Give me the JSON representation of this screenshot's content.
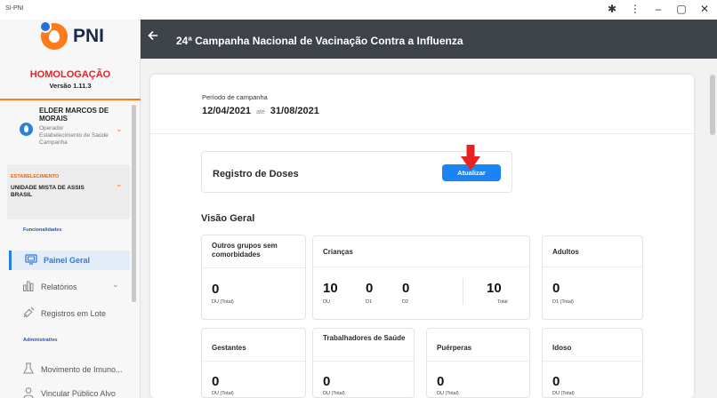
{
  "window": {
    "app_name": "SI-PNI",
    "controls": {
      "extensions": "✱",
      "menu": "⋮",
      "minimize": "–",
      "maximize": "▢",
      "close": "✕"
    }
  },
  "sidebar": {
    "logo_text": "PNI",
    "environment": "HOMOLOGAÇÃO",
    "version": "Versão 1.11.3",
    "user": {
      "name": "ELDER MARCOS DE MORAIS",
      "role": "Operador",
      "unit": "Estabelecimento de Saúde Campanha"
    },
    "establishment": {
      "title": "ESTABELECIMENTO",
      "name": "UNIDADE MISTA DE ASSIS BRASIL"
    },
    "sections": [
      {
        "label": "Funcionalidades"
      },
      {
        "label": "Administrativo"
      }
    ],
    "nav": [
      {
        "label": "Painel Geral",
        "icon": "monitor-icon",
        "active": true
      },
      {
        "label": "Relatórios",
        "icon": "chart-icon",
        "active": false
      },
      {
        "label": "Registros em Lote",
        "icon": "syringe-icon",
        "active": false
      },
      {
        "label": "Movimento de Imuno...",
        "icon": "flask-icon",
        "active": false
      },
      {
        "label": "Vincular Público Alvo",
        "icon": "user-link-icon",
        "active": false
      }
    ]
  },
  "header": {
    "title": "24ª Campanha Nacional de Vacinação Contra a Influenza",
    "background": "#3e4349"
  },
  "period": {
    "label": "Período de campanha",
    "start": "12/04/2021",
    "separator": "até",
    "end": "31/08/2021"
  },
  "doses": {
    "title": "Registro de Doses",
    "button_label": "Atualizar",
    "button_color": "#1a84f5"
  },
  "overview": {
    "title": "Visão Geral",
    "cards": [
      {
        "title": "Outros grupos sem comorbidades",
        "items": [
          {
            "value": "0",
            "label": "DU (Total)"
          }
        ]
      },
      {
        "title": "Crianças",
        "items": [
          {
            "value": "10",
            "label": "DU"
          },
          {
            "value": "0",
            "label": "D1"
          },
          {
            "value": "0",
            "label": "D2"
          },
          {
            "value": "10",
            "label": "Total"
          }
        ]
      },
      {
        "title": "Adultos",
        "items": [
          {
            "value": "0",
            "label": "D1 (Total)"
          }
        ]
      },
      {
        "title": "Gestantes",
        "items": [
          {
            "value": "0",
            "label": "DU (Total)"
          }
        ]
      },
      {
        "title": "Trabalhadores de Saúde",
        "items": [
          {
            "value": "0",
            "label": "DU (Total)"
          }
        ]
      },
      {
        "title": "Puérperas",
        "items": [
          {
            "value": "0",
            "label": "DU (Total)"
          }
        ]
      },
      {
        "title": "Idoso",
        "items": [
          {
            "value": "0",
            "label": "DU (Total)"
          }
        ]
      }
    ]
  },
  "colors": {
    "accent": "#ff7a1a",
    "env": "#e0262a",
    "primary": "#2b7be0",
    "annotation_arrow": "#e8231f"
  }
}
